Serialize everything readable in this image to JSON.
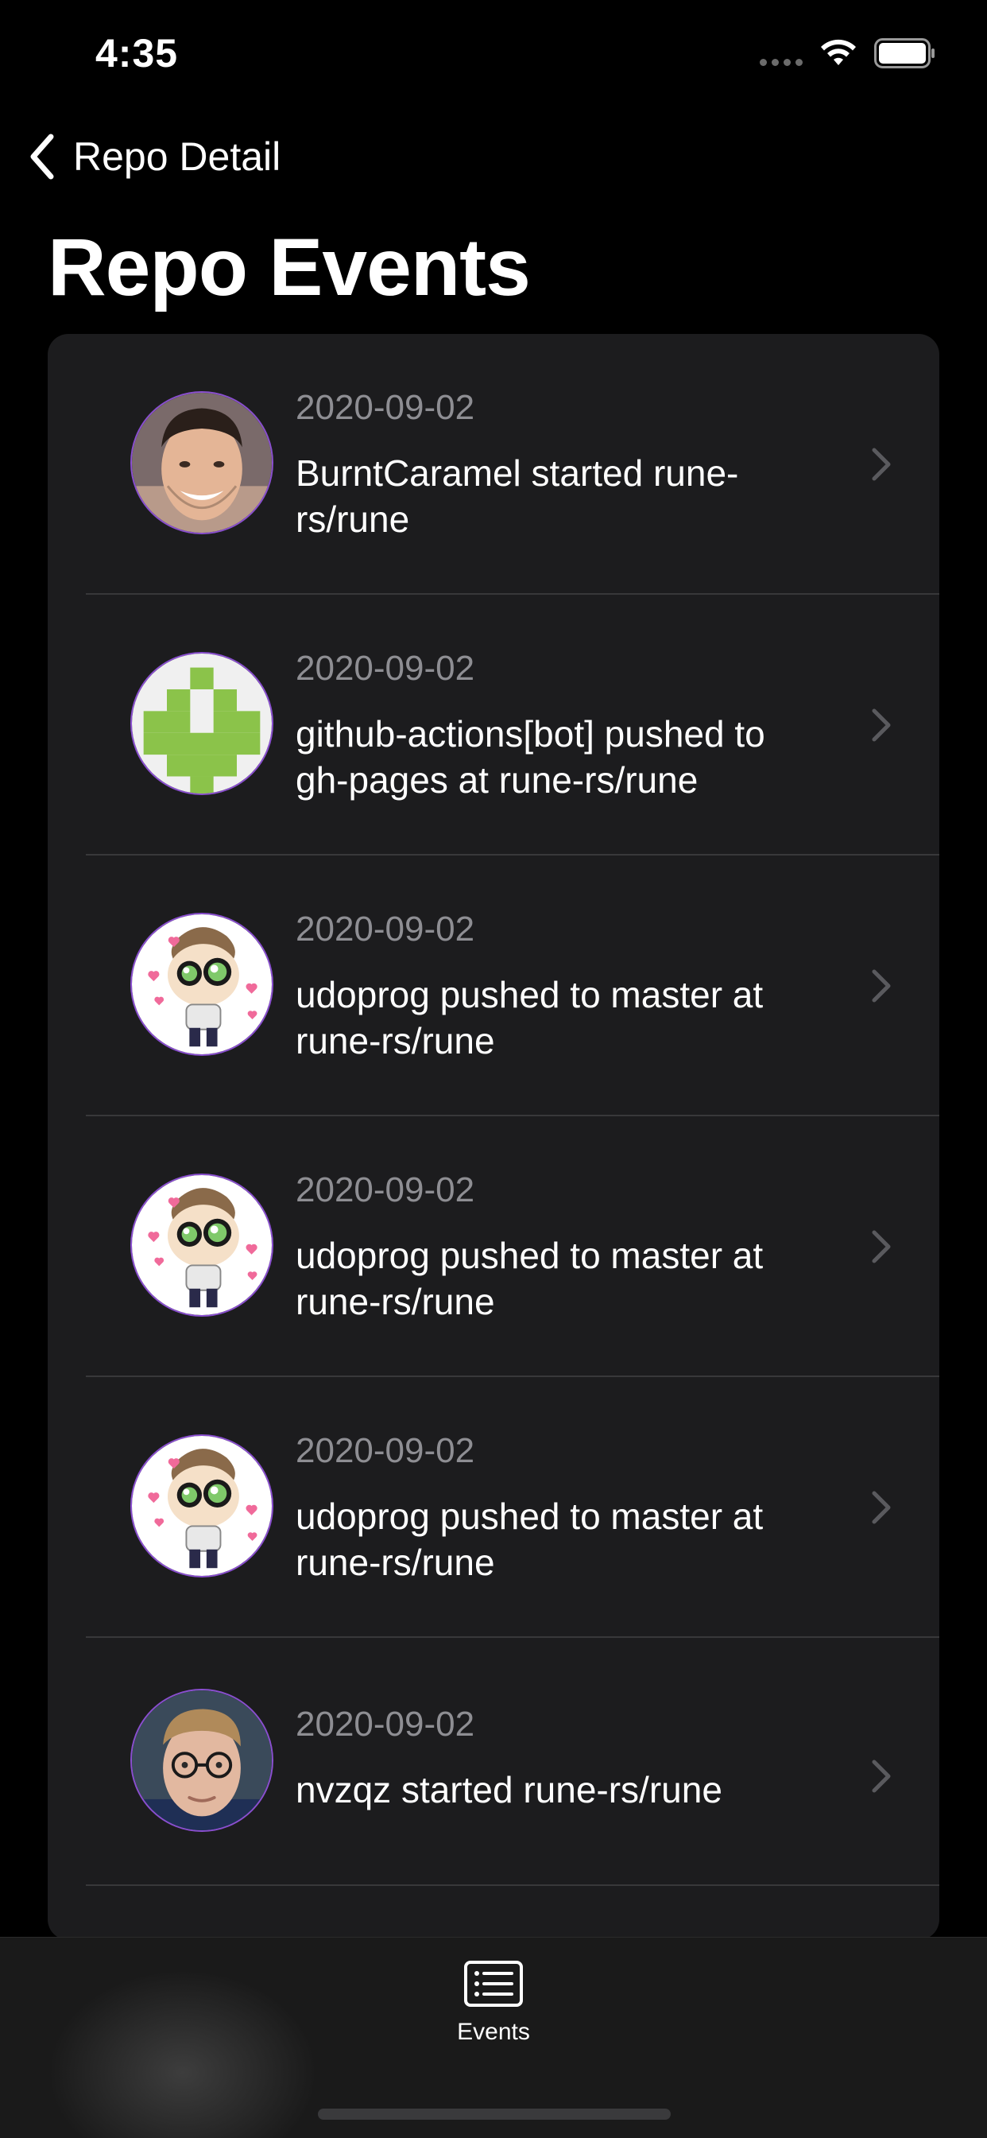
{
  "status_bar": {
    "time": "4:35"
  },
  "nav": {
    "back_label": "Repo Detail",
    "title": "Repo Events"
  },
  "events": [
    {
      "date": "2020-09-02",
      "text": "BurntCaramel started rune-rs/rune",
      "avatar": "person-photo-avatar"
    },
    {
      "date": "2020-09-02",
      "text": "github-actions[bot] pushed to gh-pages at rune-rs/rune",
      "avatar": "github-actions-identicon-avatar"
    },
    {
      "date": "2020-09-02",
      "text": "udoprog pushed to master at rune-rs/rune",
      "avatar": "cartoon-avatar"
    },
    {
      "date": "2020-09-02",
      "text": "udoprog pushed to master at rune-rs/rune",
      "avatar": "cartoon-avatar"
    },
    {
      "date": "2020-09-02",
      "text": "udoprog pushed to master at rune-rs/rune",
      "avatar": "cartoon-avatar"
    },
    {
      "date": "2020-09-02",
      "text": "nvzqz started rune-rs/rune",
      "avatar": "person-photo-avatar"
    }
  ],
  "tab_bar": {
    "tabs": [
      {
        "label": "Events",
        "icon": "list-icon",
        "selected": true
      }
    ]
  },
  "colors": {
    "background": "#000000",
    "card": "#1c1c1e",
    "secondary_text": "#8e8e93",
    "avatar_border": "#8a4fd0",
    "identicon_green": "#8bc34a"
  }
}
